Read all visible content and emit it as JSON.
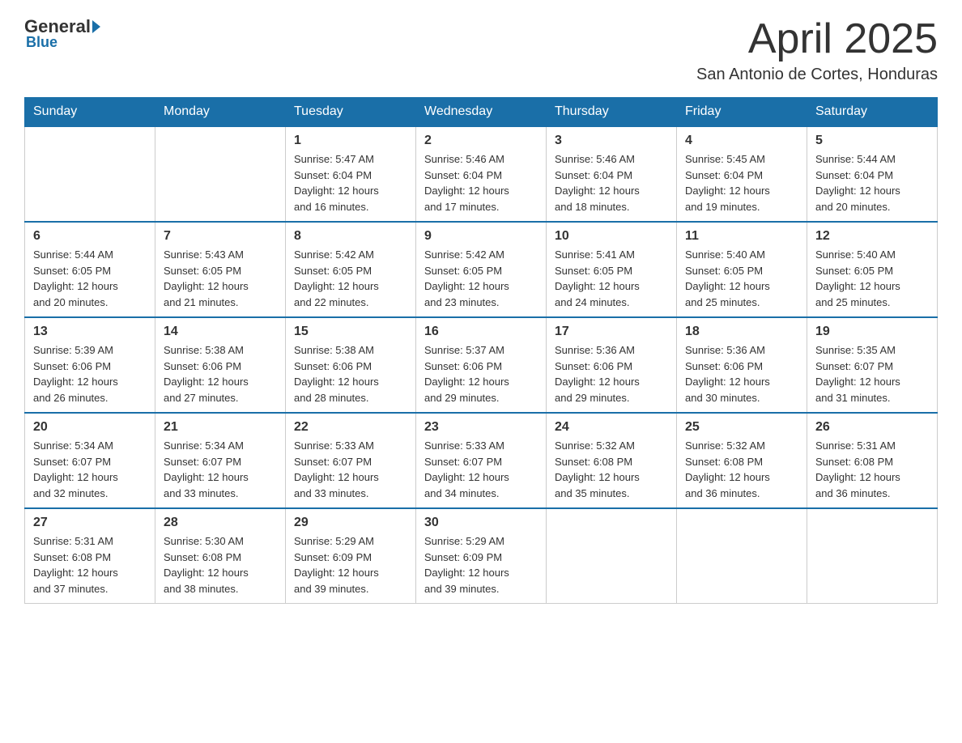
{
  "header": {
    "logo": {
      "general": "General",
      "blue": "Blue",
      "sub": "Blue"
    },
    "title": "April 2025",
    "location": "San Antonio de Cortes, Honduras"
  },
  "days_of_week": [
    "Sunday",
    "Monday",
    "Tuesday",
    "Wednesday",
    "Thursday",
    "Friday",
    "Saturday"
  ],
  "weeks": [
    [
      {
        "day": "",
        "info": ""
      },
      {
        "day": "",
        "info": ""
      },
      {
        "day": "1",
        "info": "Sunrise: 5:47 AM\nSunset: 6:04 PM\nDaylight: 12 hours\nand 16 minutes."
      },
      {
        "day": "2",
        "info": "Sunrise: 5:46 AM\nSunset: 6:04 PM\nDaylight: 12 hours\nand 17 minutes."
      },
      {
        "day": "3",
        "info": "Sunrise: 5:46 AM\nSunset: 6:04 PM\nDaylight: 12 hours\nand 18 minutes."
      },
      {
        "day": "4",
        "info": "Sunrise: 5:45 AM\nSunset: 6:04 PM\nDaylight: 12 hours\nand 19 minutes."
      },
      {
        "day": "5",
        "info": "Sunrise: 5:44 AM\nSunset: 6:04 PM\nDaylight: 12 hours\nand 20 minutes."
      }
    ],
    [
      {
        "day": "6",
        "info": "Sunrise: 5:44 AM\nSunset: 6:05 PM\nDaylight: 12 hours\nand 20 minutes."
      },
      {
        "day": "7",
        "info": "Sunrise: 5:43 AM\nSunset: 6:05 PM\nDaylight: 12 hours\nand 21 minutes."
      },
      {
        "day": "8",
        "info": "Sunrise: 5:42 AM\nSunset: 6:05 PM\nDaylight: 12 hours\nand 22 minutes."
      },
      {
        "day": "9",
        "info": "Sunrise: 5:42 AM\nSunset: 6:05 PM\nDaylight: 12 hours\nand 23 minutes."
      },
      {
        "day": "10",
        "info": "Sunrise: 5:41 AM\nSunset: 6:05 PM\nDaylight: 12 hours\nand 24 minutes."
      },
      {
        "day": "11",
        "info": "Sunrise: 5:40 AM\nSunset: 6:05 PM\nDaylight: 12 hours\nand 25 minutes."
      },
      {
        "day": "12",
        "info": "Sunrise: 5:40 AM\nSunset: 6:05 PM\nDaylight: 12 hours\nand 25 minutes."
      }
    ],
    [
      {
        "day": "13",
        "info": "Sunrise: 5:39 AM\nSunset: 6:06 PM\nDaylight: 12 hours\nand 26 minutes."
      },
      {
        "day": "14",
        "info": "Sunrise: 5:38 AM\nSunset: 6:06 PM\nDaylight: 12 hours\nand 27 minutes."
      },
      {
        "day": "15",
        "info": "Sunrise: 5:38 AM\nSunset: 6:06 PM\nDaylight: 12 hours\nand 28 minutes."
      },
      {
        "day": "16",
        "info": "Sunrise: 5:37 AM\nSunset: 6:06 PM\nDaylight: 12 hours\nand 29 minutes."
      },
      {
        "day": "17",
        "info": "Sunrise: 5:36 AM\nSunset: 6:06 PM\nDaylight: 12 hours\nand 29 minutes."
      },
      {
        "day": "18",
        "info": "Sunrise: 5:36 AM\nSunset: 6:06 PM\nDaylight: 12 hours\nand 30 minutes."
      },
      {
        "day": "19",
        "info": "Sunrise: 5:35 AM\nSunset: 6:07 PM\nDaylight: 12 hours\nand 31 minutes."
      }
    ],
    [
      {
        "day": "20",
        "info": "Sunrise: 5:34 AM\nSunset: 6:07 PM\nDaylight: 12 hours\nand 32 minutes."
      },
      {
        "day": "21",
        "info": "Sunrise: 5:34 AM\nSunset: 6:07 PM\nDaylight: 12 hours\nand 33 minutes."
      },
      {
        "day": "22",
        "info": "Sunrise: 5:33 AM\nSunset: 6:07 PM\nDaylight: 12 hours\nand 33 minutes."
      },
      {
        "day": "23",
        "info": "Sunrise: 5:33 AM\nSunset: 6:07 PM\nDaylight: 12 hours\nand 34 minutes."
      },
      {
        "day": "24",
        "info": "Sunrise: 5:32 AM\nSunset: 6:08 PM\nDaylight: 12 hours\nand 35 minutes."
      },
      {
        "day": "25",
        "info": "Sunrise: 5:32 AM\nSunset: 6:08 PM\nDaylight: 12 hours\nand 36 minutes."
      },
      {
        "day": "26",
        "info": "Sunrise: 5:31 AM\nSunset: 6:08 PM\nDaylight: 12 hours\nand 36 minutes."
      }
    ],
    [
      {
        "day": "27",
        "info": "Sunrise: 5:31 AM\nSunset: 6:08 PM\nDaylight: 12 hours\nand 37 minutes."
      },
      {
        "day": "28",
        "info": "Sunrise: 5:30 AM\nSunset: 6:08 PM\nDaylight: 12 hours\nand 38 minutes."
      },
      {
        "day": "29",
        "info": "Sunrise: 5:29 AM\nSunset: 6:09 PM\nDaylight: 12 hours\nand 39 minutes."
      },
      {
        "day": "30",
        "info": "Sunrise: 5:29 AM\nSunset: 6:09 PM\nDaylight: 12 hours\nand 39 minutes."
      },
      {
        "day": "",
        "info": ""
      },
      {
        "day": "",
        "info": ""
      },
      {
        "day": "",
        "info": ""
      }
    ]
  ]
}
